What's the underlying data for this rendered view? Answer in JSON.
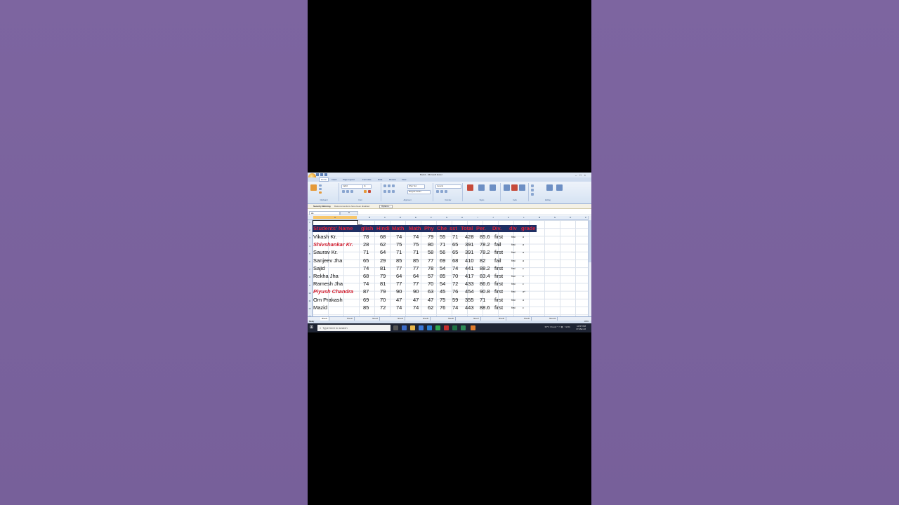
{
  "window": {
    "title": "Book1 - Microsoft Excel",
    "controls": [
      "–",
      "□",
      "×"
    ]
  },
  "ribbon_tabs": [
    "Home",
    "Insert",
    "Page Layout",
    "Formulas",
    "Data",
    "Review",
    "View"
  ],
  "ribbon": {
    "groups": [
      "Clipboard",
      "Font",
      "Alignment",
      "Number",
      "Styles",
      "Cells",
      "Editing"
    ],
    "font_name": "Calibri",
    "font_size": "11",
    "number_format": "General",
    "wrap_text": "Wrap Text",
    "merge_center": "Merge & Center",
    "conditional": "Conditional Formatting",
    "format_table": "Format as Table",
    "cell_styles": "Cell Styles",
    "insert": "Insert",
    "delete": "Delete",
    "format": "Format",
    "autosum": "AutoSum",
    "fill": "Fill",
    "clear": "Clear",
    "sort_filter": "Sort & Filter",
    "find_select": "Find & Select",
    "paste": "Paste",
    "cut": "Cut",
    "copy": "Copy",
    "format_painter": "Format Painter"
  },
  "security_bar": {
    "label": "Security Warning",
    "message": "Data connections have been disabled",
    "options_button": "Options..."
  },
  "formula_bar": {
    "name_box": "A1",
    "fx": "fx"
  },
  "columns": [
    "A",
    "B",
    "C",
    "D",
    "E",
    "F",
    "G",
    "H",
    "I",
    "J",
    "K",
    "L",
    "M",
    "N",
    "O",
    "P",
    "Q"
  ],
  "row_numbers": [
    "1",
    "2",
    "3",
    "4",
    "5",
    "6",
    "7",
    "8",
    "9",
    "10",
    "11",
    "12",
    "13"
  ],
  "table": {
    "headers": [
      "Students' Name",
      "English",
      "Hindi",
      "Math",
      "Math",
      "Phy",
      "Che",
      "sst",
      "Total",
      "Per.",
      "Div.",
      "div",
      "grade"
    ],
    "header_display": [
      "Students' Name",
      "glish",
      "Hindi",
      "Math",
      "Math",
      "Phy",
      "Che",
      "sst",
      "Total",
      "Per.",
      "Div.",
      "div",
      "grade"
    ],
    "rows": [
      {
        "name": "Vikash Kr.",
        "hl": false,
        "v": [
          "78",
          "68",
          "74",
          "74",
          "79",
          "55",
          "71",
          "428",
          "85.6",
          "first",
          "first",
          "a"
        ]
      },
      {
        "name": "Shivshankar Kr.",
        "hl": true,
        "v": [
          "28",
          "62",
          "75",
          "75",
          "80",
          "71",
          "65",
          "391",
          "78.2",
          "fail",
          "first",
          "a"
        ]
      },
      {
        "name": "Saurav Kr.",
        "hl": false,
        "v": [
          "71",
          "64",
          "71",
          "71",
          "58",
          "56",
          "65",
          "391",
          "78.2",
          "first",
          "first",
          "a"
        ]
      },
      {
        "name": "Sanjeev Jha",
        "hl": false,
        "v": [
          "65",
          "29",
          "85",
          "85",
          "77",
          "69",
          "68",
          "410",
          "82",
          "fail",
          "first",
          "a"
        ]
      },
      {
        "name": "Sajid",
        "hl": false,
        "v": [
          "74",
          "81",
          "77",
          "77",
          "78",
          "54",
          "74",
          "441",
          "88.2",
          "first",
          "first",
          "c"
        ]
      },
      {
        "name": "Rekha Jha",
        "hl": false,
        "v": [
          "68",
          "79",
          "64",
          "64",
          "57",
          "85",
          "70",
          "417",
          "83.4",
          "first",
          "first",
          "c"
        ]
      },
      {
        "name": "Ramesh Jha",
        "hl": false,
        "v": [
          "74",
          "81",
          "77",
          "77",
          "70",
          "54",
          "72",
          "433",
          "86.6",
          "first",
          "first",
          "c"
        ]
      },
      {
        "name": "Piyush Chandra",
        "hl": true,
        "v": [
          "87",
          "79",
          "90",
          "90",
          "63",
          "45",
          "76",
          "454",
          "90.8",
          "first",
          "first",
          "a+"
        ]
      },
      {
        "name": "Om Prakash",
        "hl": false,
        "v": [
          "69",
          "70",
          "47",
          "47",
          "47",
          "75",
          "59",
          "355",
          "71",
          "first",
          "first",
          "a"
        ]
      },
      {
        "name": "Mazid",
        "hl": false,
        "v": [
          "85",
          "72",
          "74",
          "74",
          "62",
          "76",
          "74",
          "443",
          "88.6",
          "first",
          "first",
          "c"
        ]
      }
    ]
  },
  "sheet_tabs": [
    "Sheet1",
    "Sheet2",
    "Sheet3",
    "Sheet4",
    "Sheet5",
    "Sheet6",
    "Sheet7",
    "Sheet8",
    "Sheet9",
    "Sheet10"
  ],
  "status": {
    "ready": "Ready",
    "zoom": "100%"
  },
  "taskbar": {
    "search_placeholder": "Type here to search",
    "weather": "36°C Cloudy",
    "lang": "ENG",
    "time": "14:57 PM",
    "date": "17-Mar-22"
  },
  "colors": {
    "header_bg": "#1f2f63",
    "header_text": "#e0213a",
    "highlight_name": "#d41f2f",
    "background": "#7a6399"
  }
}
